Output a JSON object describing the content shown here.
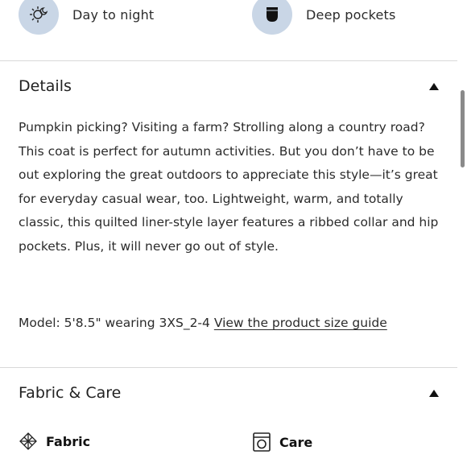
{
  "features": [
    {
      "icon": "day-night-icon",
      "label": "Day to night"
    },
    {
      "icon": "pocket-icon",
      "label": "Deep pockets"
    }
  ],
  "details": {
    "title": "Details",
    "description": "Pumpkin picking? Visiting a farm? Strolling along a country road? This coat is perfect for autumn activities. But you don’t have to be out exploring the great outdoors to appreciate this style—it’s great for everyday casual wear, too. Lightweight, warm, and totally classic, this quilted liner-style layer features a ribbed collar and hip pockets. Plus, it will never go out of style.",
    "model_text": "Model: 5'8.5\" wearing 3XS_2-4",
    "size_guide_link": "View the product size guide"
  },
  "fabric_care": {
    "title": "Fabric & Care",
    "items": [
      {
        "icon": "fabric-icon",
        "label": "Fabric"
      },
      {
        "icon": "washer-icon",
        "label": "Care"
      }
    ]
  },
  "colors": {
    "feature_circle": "#c9d6e6",
    "text": "#2b2b2b",
    "divider": "#d9d9d9"
  }
}
